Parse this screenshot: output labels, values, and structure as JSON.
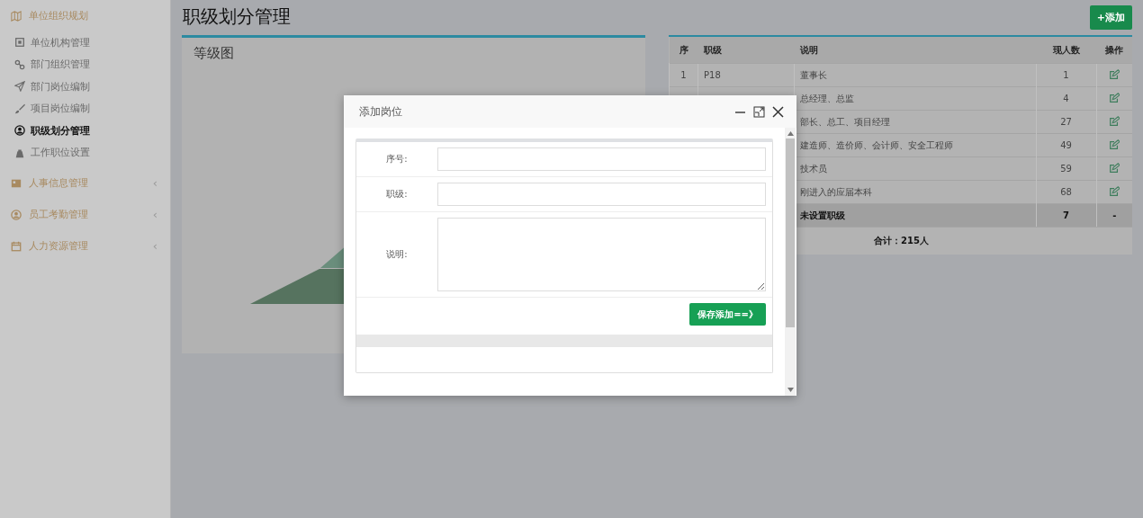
{
  "sidebar": {
    "groups": [
      {
        "label": "单位组织规划",
        "expanded": true,
        "children": [
          {
            "label": "单位机构管理",
            "selected": false
          },
          {
            "label": "部门组织管理",
            "selected": false
          },
          {
            "label": "部门岗位编制",
            "selected": false
          },
          {
            "label": "项目岗位编制",
            "selected": false
          },
          {
            "label": "职级划分管理",
            "selected": true
          },
          {
            "label": "工作职位设置",
            "selected": false
          }
        ]
      },
      {
        "label": "人事信息管理",
        "expanded": false,
        "toggle": "‹"
      },
      {
        "label": "员工考勤管理",
        "expanded": false,
        "toggle": "‹"
      },
      {
        "label": "人力资源管理",
        "expanded": false,
        "toggle": "‹"
      }
    ]
  },
  "page": {
    "title": "职级划分管理",
    "add_button": "+添加"
  },
  "grade_panel": {
    "title": "等级图"
  },
  "table": {
    "columns": [
      "序",
      "职级",
      "说明",
      "现人数",
      "操作"
    ],
    "rows": [
      {
        "seq": "1",
        "level": "P18",
        "description": "董事长",
        "count": "1"
      },
      {
        "description": "总经理、总监",
        "count": "4"
      },
      {
        "description": "部长、总工、项目经理",
        "count": "27"
      },
      {
        "description": "建造师、造价师、会计师、安全工程师",
        "count": "49"
      },
      {
        "description": "技术员",
        "count": "59"
      },
      {
        "description": "刚进入的应届本科",
        "count": "68"
      }
    ],
    "summary": {
      "label": "未设置职级",
      "count": "7",
      "action": "-"
    },
    "total": "合计：215人"
  },
  "dialog": {
    "title": "添加岗位",
    "fields": [
      {
        "label": "序号:",
        "kind": "input"
      },
      {
        "label": "职级:",
        "kind": "input"
      },
      {
        "label": "说明:",
        "kind": "textarea"
      }
    ],
    "submit": "保存添加==》"
  }
}
